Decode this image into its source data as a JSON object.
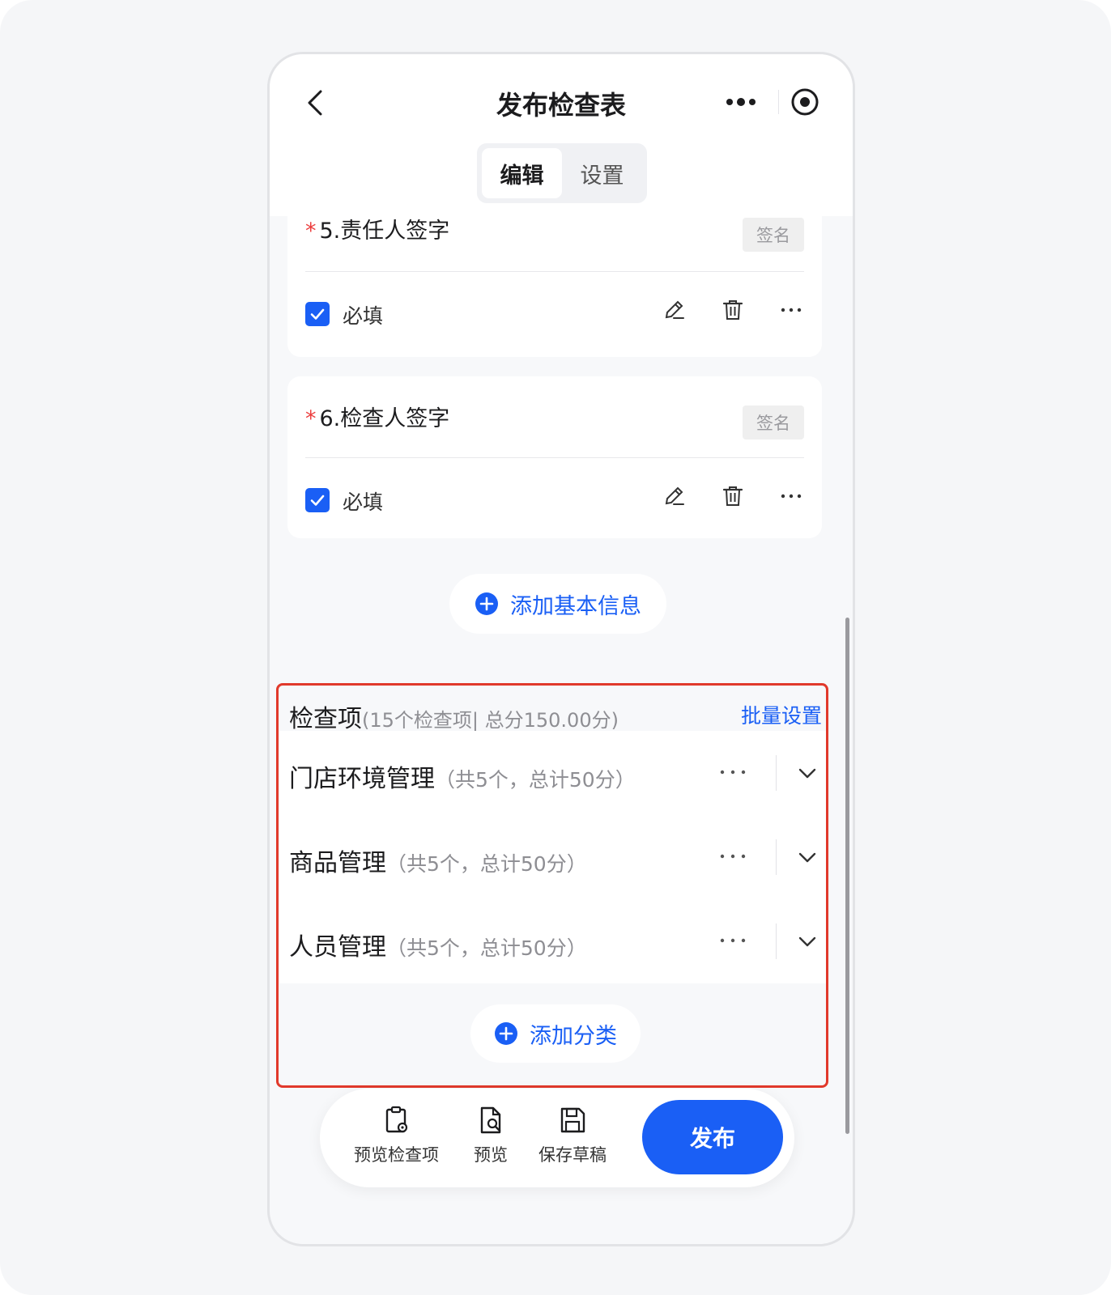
{
  "header": {
    "title": "发布检查表",
    "tabs": [
      {
        "label": "编辑",
        "active": true
      },
      {
        "label": "设置",
        "active": false
      }
    ]
  },
  "fields": [
    {
      "number_title": "5.责任人签字",
      "required_mark": "*",
      "type_tag": "签名",
      "required_label": "必填",
      "required_checked": true
    },
    {
      "number_title": "6.检查人签字",
      "required_mark": "*",
      "type_tag": "签名",
      "required_label": "必填",
      "required_checked": true
    }
  ],
  "add_basic_info_label": "添加基本信息",
  "inspection": {
    "title": "检查项",
    "summary": "(15个检查项| 总分150.00分)",
    "batch_label": "批量设置",
    "categories": [
      {
        "name": "门店环境管理",
        "meta": "（共5个，总计50分）"
      },
      {
        "name": "商品管理",
        "meta": "（共5个，总计50分）"
      },
      {
        "name": "人员管理",
        "meta": "（共5个，总计50分）"
      }
    ],
    "add_category_label": "添加分类"
  },
  "bottom_bar": {
    "preview_items_label": "预览检查项",
    "preview_label": "预览",
    "save_draft_label": "保存草稿",
    "publish_label": "发布"
  },
  "colors": {
    "accent": "#1a5ff5",
    "required": "#ec3e3e",
    "highlight_box": "#e1392b"
  }
}
